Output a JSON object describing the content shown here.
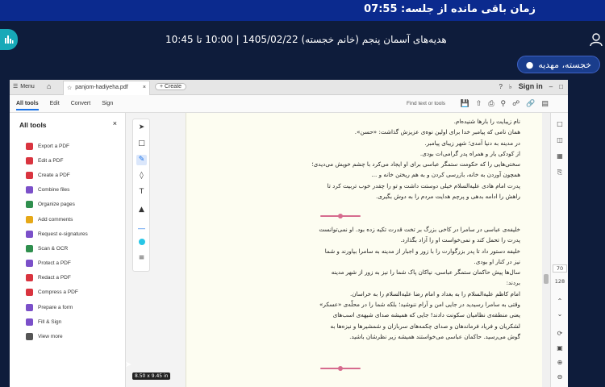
{
  "meeting": {
    "timer": "زمان باقی مانده از جلسه: 07:55",
    "session_title": "هدیه‌های آسمان پنجم (خانم خجسته) 1405/02/22 | 10:00 تا 10:45",
    "user_badge": "خجسته، مهدیه",
    "brand_color": "#17a9b8"
  },
  "pdf_app": {
    "menu_label": "Menu",
    "tab_filename": "panjom-hadiyeha.pdf",
    "create_label": "+ Create",
    "sign_in": "Sign in",
    "top_menus": [
      "All tools",
      "Edit",
      "Convert",
      "Sign"
    ],
    "find_text": "Find text or tools",
    "panel_title": "All tools",
    "tools": [
      {
        "label": "Export a PDF",
        "icon": "export-icon",
        "color": "#d9343f"
      },
      {
        "label": "Edit a PDF",
        "icon": "edit-icon",
        "color": "#d9343f"
      },
      {
        "label": "Create a PDF",
        "icon": "create-icon",
        "color": "#d9343f"
      },
      {
        "label": "Combine files",
        "icon": "combine-icon",
        "color": "#7b50c9"
      },
      {
        "label": "Organize pages",
        "icon": "organize-icon",
        "color": "#2f8f4e"
      },
      {
        "label": "Add comments",
        "icon": "comment-icon",
        "color": "#e6a817"
      },
      {
        "label": "Request e-signatures",
        "icon": "esign-icon",
        "color": "#7b50c9"
      },
      {
        "label": "Scan & OCR",
        "icon": "scan-icon",
        "color": "#2f8f4e"
      },
      {
        "label": "Protect a PDF",
        "icon": "protect-icon",
        "color": "#7b50c9"
      },
      {
        "label": "Redact a PDF",
        "icon": "redact-icon",
        "color": "#d9343f"
      },
      {
        "label": "Compress a PDF",
        "icon": "compress-icon",
        "color": "#d9343f"
      },
      {
        "label": "Prepare a form",
        "icon": "form-icon",
        "color": "#7b50c9"
      },
      {
        "label": "Fill & Sign",
        "icon": "fillsign-icon",
        "color": "#7b50c9"
      },
      {
        "label": "View more",
        "icon": "more-icon",
        "color": "#555555"
      }
    ],
    "page_number": "70",
    "page_total": "128",
    "tooltip": "8.50 x 9.45 in"
  },
  "document": {
    "paragraph1": [
      "نام زیبایت را بارها شنیده‌ام.",
      "همان نامی که پیامبر خدا برای اولین نوه‌ی عزیزش گذاشت: «حسن».",
      "در مدینه به دنیا آمدی؛ شهر زیبای پیامبر.",
      "از کودکی یار و همراه پدر گرامی‌ات بودی.",
      "سختی‌هایی را که حکومت ستمگر عباسی برای او ایجاد می‌کرد با چشم خویش می‌دیدی؛",
      "همچون آوردن به خانه، بازرسی کردن و به هم ریختن خانه و ...",
      "پدرت امام هادی علیه‌السلام خیلی دوستت داشت و تو را چقدر خوب تربیت کرد تا",
      "راهش را ادامه بدهی و پرچم هدایت مردم را به دوش بگیری."
    ],
    "paragraph2": [
      "خلیفه‌ی عباسی در سامرا در کاخی بزرگ بر تخت قدرت تکیه زده بود. او نمی‌توانست",
      "پدرت را تحمل کند و نمی‌خواست او را آزاد بگذارد.",
      "خلیفه دستور داد تا پدر بزرگوارت را با زور و اجبار از مدینه به سامرا بیاورند و شما",
      "نیز در کنار او بودی.",
      "سال‌ها پیش حاکمان ستمگر عباسی، نیاکان پاک شما را نیز به زور از شهر مدینه",
      "بردند:",
      "امام کاظم علیه‌السلام را به بغداد و امام رضا علیه‌السلام را به خراسان.",
      "وقتی به سامرا رسیدید در جایی امن و آرام ننوشید؛ بلکه شما را در محلّه‌ی «عسکر»",
      "یعنی منطقه‌ی نظامیان سکونت دادند! جایی که همیشه صدای شیهه‌ی اسب‌های",
      "لشکریان و فریاد فرماندهان و صدای چکمه‌های سربازان و شمشیرها و نیزه‌ها به",
      "گوش می‌رسید. حاکمان عباسی می‌خواستند همیشه زیر نظرشان باشید."
    ]
  }
}
